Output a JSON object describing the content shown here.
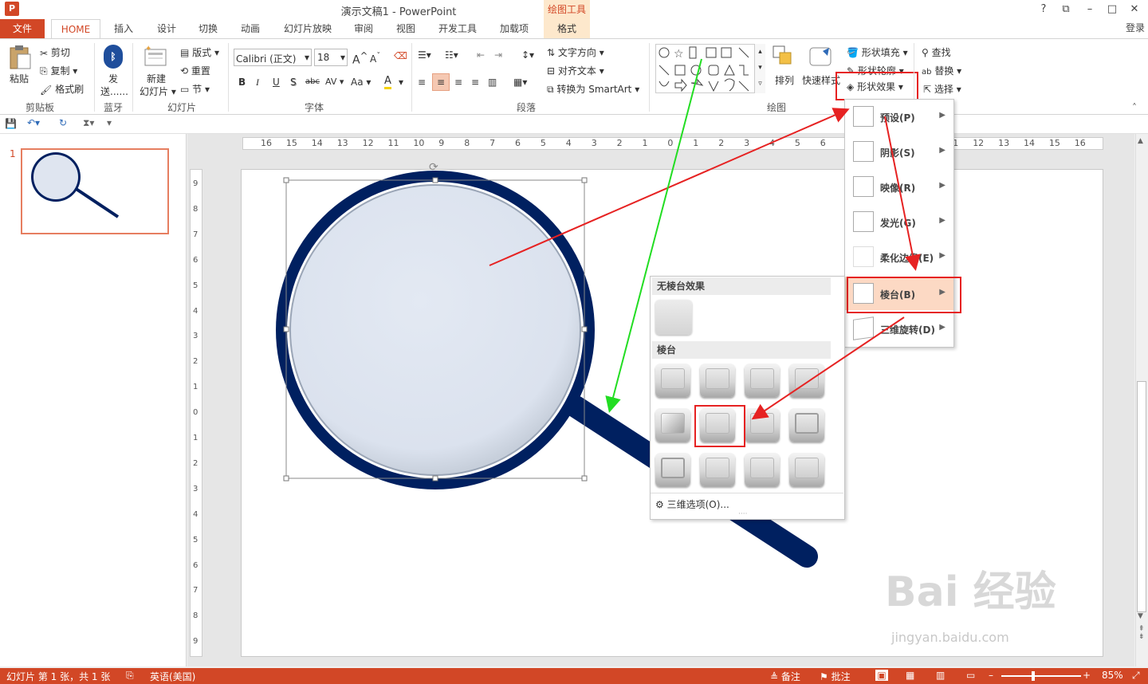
{
  "window": {
    "title": "演示文稿1 - PowerPoint",
    "contextual_group": "绘图工具",
    "controls": [
      "?",
      "⧉",
      "–",
      "□",
      "✕"
    ],
    "login": "登录"
  },
  "tabs": [
    "文件",
    "HOME",
    "插入",
    "设计",
    "切换",
    "动画",
    "幻灯片放映",
    "审阅",
    "视图",
    "开发工具",
    "加载项",
    "格式"
  ],
  "ribbon": {
    "clipboard": {
      "paste": "粘贴",
      "cut": "剪切",
      "copy": "复制",
      "format_painter": "格式刷",
      "label": "剪贴板"
    },
    "bluetooth": {
      "send": "发",
      "send2": "送......",
      "label": "蓝牙"
    },
    "slides": {
      "new_slide": "新建",
      "new_slide2": "幻灯片",
      "layout": "版式",
      "reset": "重置",
      "section": "节",
      "label": "幻灯片"
    },
    "font": {
      "name": "Calibri (正文)",
      "size": "18",
      "bold": "B",
      "italic": "I",
      "underline": "U",
      "shadow": "S",
      "strike": "abc",
      "spacing": "AV",
      "case": "Aa",
      "color": "A",
      "label": "字体"
    },
    "paragraph": {
      "text_direction": "文字方向",
      "align_text": "对齐文本",
      "convert_smartart": "转换为 SmartArt",
      "label": "段落"
    },
    "drawing": {
      "arrange": "排列",
      "quick_styles": "快速样式",
      "shape_fill": "形状填充",
      "shape_outline": "形状轮廓",
      "shape_effects": "形状效果",
      "label": "绘图"
    },
    "editing": {
      "find": "查找",
      "replace": "替换",
      "select": "选择"
    }
  },
  "effects_menu": [
    {
      "label": "预设(P)"
    },
    {
      "label": "阴影(S)"
    },
    {
      "label": "映像(R)"
    },
    {
      "label": "发光(G)"
    },
    {
      "label": "柔化边缘(E)"
    },
    {
      "label": "棱台(B)"
    },
    {
      "label": "三维旋转(D)"
    }
  ],
  "bevel_gallery": {
    "no_bevel_header": "无棱台效果",
    "bevel_header": "棱台",
    "options_link": "三维选项(O)...",
    "grid_rows": 3,
    "grid_cols": 4,
    "highlighted_index": 5
  },
  "slides_panel": {
    "slide_number": "1"
  },
  "ruler_h": [
    "16",
    "15",
    "14",
    "13",
    "12",
    "11",
    "10",
    "9",
    "8",
    "7",
    "6",
    "5",
    "4",
    "3",
    "2",
    "1",
    "0",
    "1",
    "2",
    "3",
    "4",
    "5",
    "6",
    "7",
    "8",
    "9",
    "10",
    "11",
    "12",
    "13",
    "14",
    "15",
    "16"
  ],
  "ruler_v": [
    "9",
    "8",
    "7",
    "6",
    "5",
    "4",
    "3",
    "2",
    "1",
    "0",
    "1",
    "2",
    "3",
    "4",
    "5",
    "6",
    "7",
    "8",
    "9"
  ],
  "status": {
    "slide_info": "幻灯片 第 1 张，共 1 张",
    "language": "英语(美国)",
    "notes": "备注",
    "comments": "批注",
    "zoom": "85%"
  },
  "watermark": {
    "brand": "Bai 经验",
    "url": "jingyan.baidu.com"
  },
  "colors": {
    "accent": "#d24726",
    "magnifier": "#002060",
    "lens": "#dfe5f0",
    "highlight": "#e62222",
    "arrow_green": "#22dd22"
  }
}
